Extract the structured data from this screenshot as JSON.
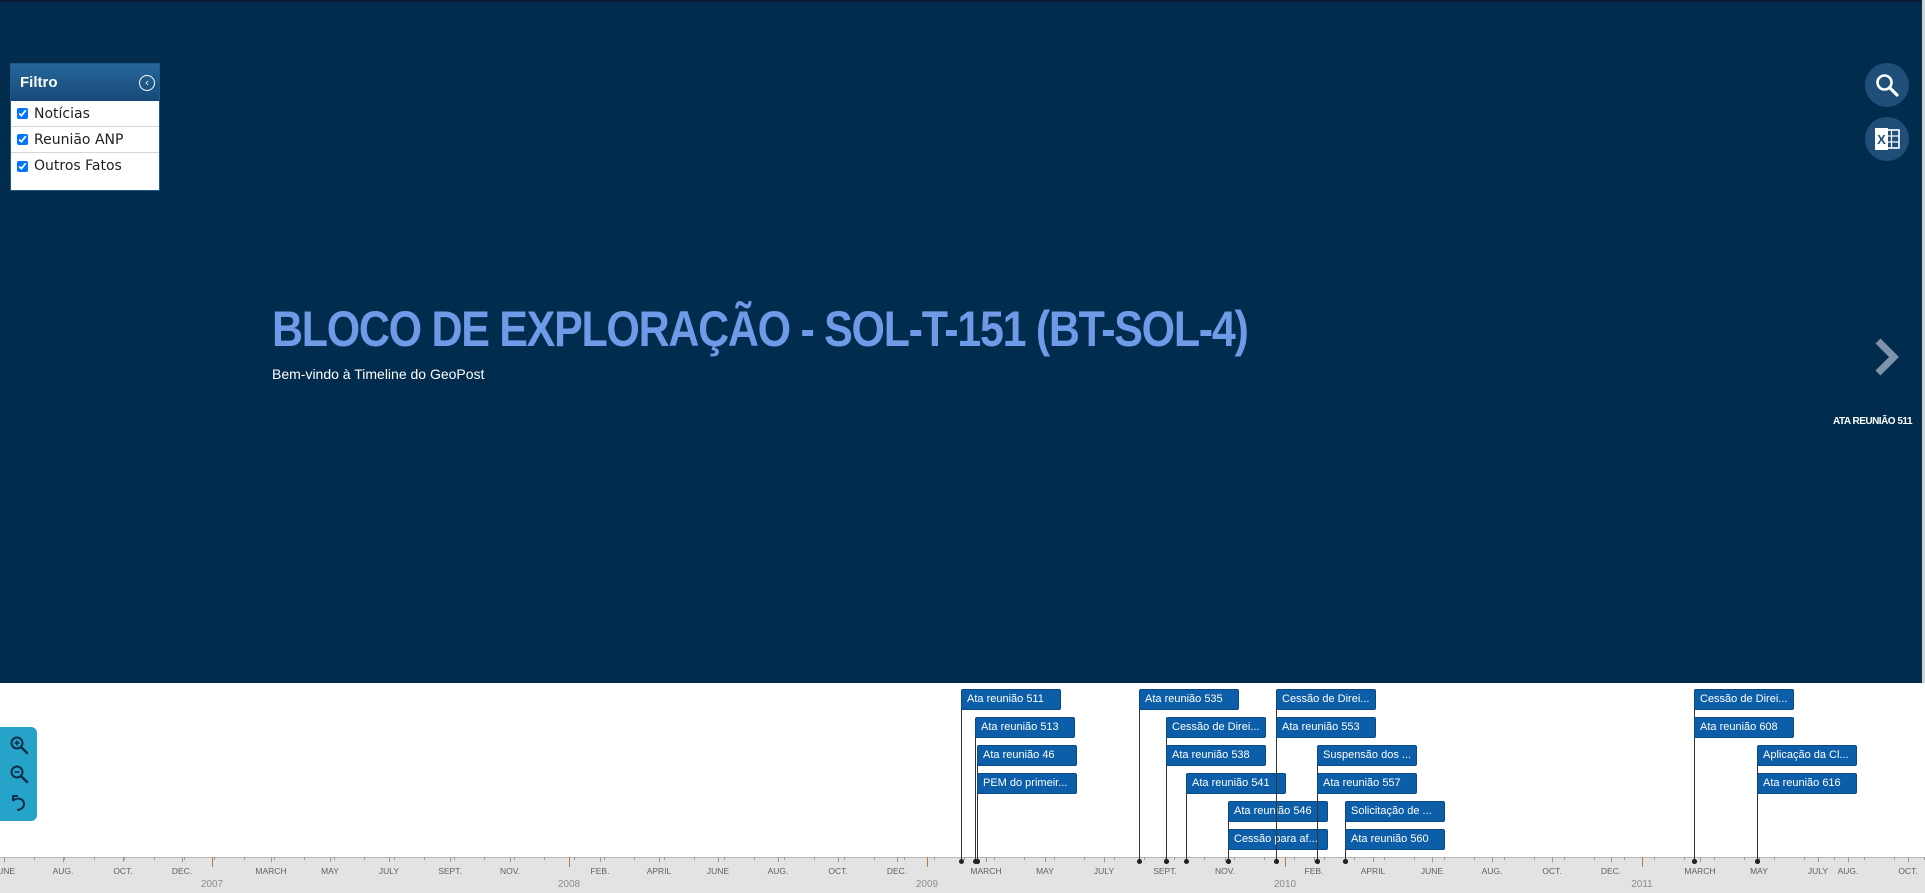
{
  "filter": {
    "title": "Filtro",
    "options": [
      {
        "label": "Notícias",
        "checked": true
      },
      {
        "label": "Reunião ANP",
        "checked": true
      },
      {
        "label": "Outros Fatos",
        "checked": true
      }
    ]
  },
  "actions": {
    "search_icon": "search-icon",
    "excel_icon": "excel-export-icon"
  },
  "slide": {
    "headline": "BLOCO DE EXPLORAÇÃO - SOL-T-151 (BT-SOL-4)",
    "subheadline": "Bem-vindo à Timeline do GeoPost",
    "next_label": "ATA REUNIÃO 511"
  },
  "colors": {
    "slide_background": "#012c4d",
    "headline": "#6f9ae8",
    "event_marker": "#0d5ea8",
    "zoom_panel": "#26a3c9"
  },
  "timeline": {
    "months": [
      "JUNE",
      "AUG.",
      "OCT.",
      "DEC.",
      "MARCH",
      "MAY",
      "JULY",
      "SEPT.",
      "NOV.",
      "FEB.",
      "APRIL",
      "JUNE",
      "AUG.",
      "OCT.",
      "DEC.",
      "MARCH",
      "MAY",
      "JULY",
      "SEPT.",
      "NOV.",
      "FEB.",
      "APRIL",
      "JUNE",
      "AUG.",
      "OCT.",
      "DEC.",
      "MARCH",
      "MAY",
      "JULY",
      "AUG.",
      "OCT."
    ],
    "years": [
      "2007",
      "2008",
      "2009",
      "2010",
      "2011"
    ],
    "events": [
      "Ata reunião 511",
      "Ata reunião 513",
      "Ata reunião 46",
      "PEM do primeir...",
      "Ata reunião 535",
      "Cessão de Direi...",
      "Ata reunião 538",
      "Ata reunião 541",
      "Ata reunião 546",
      "Cessão para af...",
      "Cessão de Direi...",
      "Ata reunião 553",
      "Suspensão dos ...",
      "Ata reunião 557",
      "Solicitação de ...",
      "Ata reunião 560",
      "Cessão de Direi...",
      "Ata reunião 608",
      "Aplicação da Cl...",
      "Ata reunião 616"
    ]
  },
  "zoom": {
    "zoom_in_icon": "zoom-in-icon",
    "zoom_out_icon": "zoom-out-icon",
    "reset_icon": "undo-icon"
  }
}
